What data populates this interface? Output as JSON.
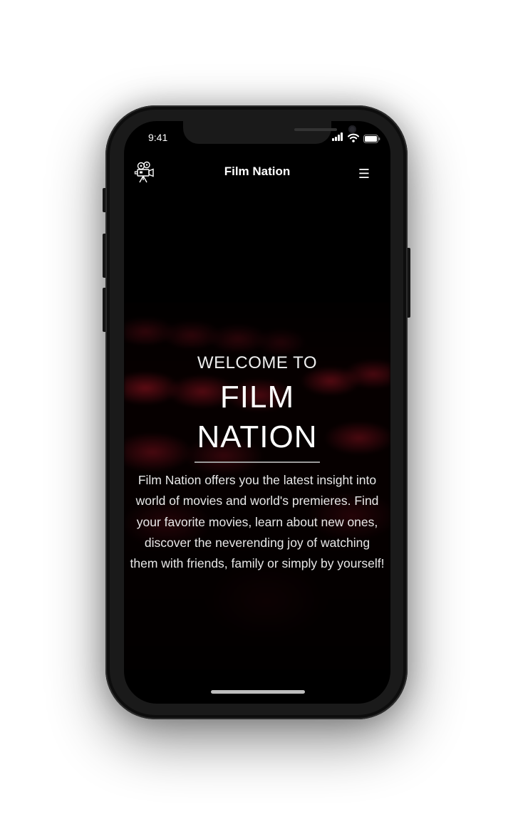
{
  "status_bar": {
    "time": "9:41"
  },
  "nav": {
    "brand": "Film Nation",
    "logo_icon": "movie-camera-icon",
    "menu_icon": "hamburger-menu-icon",
    "menu_glyph": "☰"
  },
  "hero": {
    "welcome": "WELCOME TO",
    "title_line1": "FILM",
    "title_line2": "NATION",
    "description": "Film Nation offers you the latest insight into world of movies and world's premieres. Find your favorite movies, learn about new ones, discover the neverending joy of watching them with friends, family or simply by yourself!"
  },
  "colors": {
    "background": "#000000",
    "text": "#ffffff",
    "accent_seat_red": "#9a1220",
    "divider": "#9a9a9a"
  }
}
